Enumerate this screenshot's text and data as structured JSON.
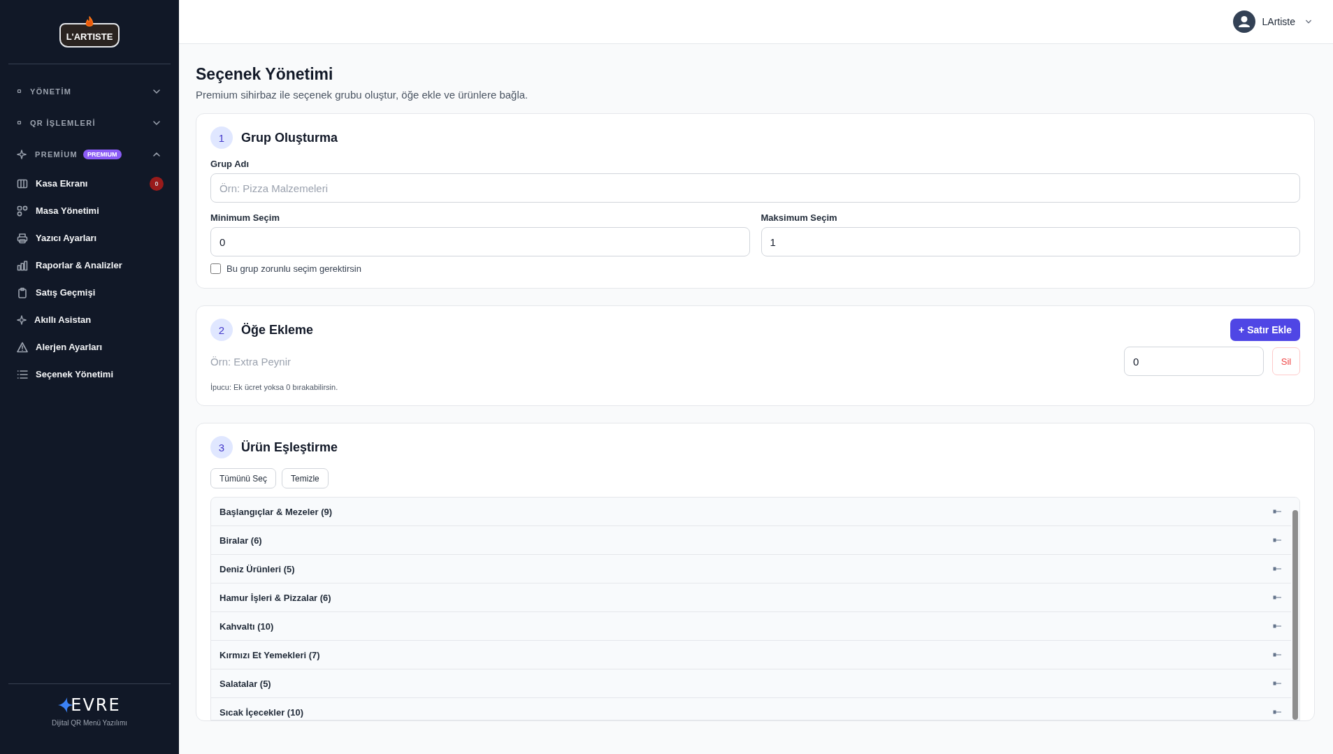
{
  "sidebar": {
    "logo": {
      "text": "L'ARTISTE"
    },
    "groups": [
      {
        "label": "YÖNETİM",
        "expanded": false
      },
      {
        "label": "QR İŞLEMLERİ",
        "expanded": false
      },
      {
        "label": "PREMİUM",
        "badge": "PREMIUM",
        "expanded": true,
        "items": [
          {
            "label": "Kasa Ekranı",
            "count": "0"
          },
          {
            "label": "Masa Yönetimi"
          },
          {
            "label": "Yazıcı Ayarları"
          },
          {
            "label": "Raporlar & Analizler"
          },
          {
            "label": "Satış Geçmişi"
          },
          {
            "label": "Akıllı Asistan"
          },
          {
            "label": "Alerjen Ayarları"
          },
          {
            "label": "Seçenek Yönetimi"
          }
        ]
      }
    ],
    "footer": {
      "brand": "EVRE",
      "caption": "Dijital QR Menü Yazılımı"
    }
  },
  "header": {
    "user": "LArtiste"
  },
  "page": {
    "title": "Seçenek Yönetimi",
    "subtitle": "Premium sihirbaz ile seçenek grubu oluştur, öğe ekle ve ürünlere bağla."
  },
  "group_step": {
    "number": "1",
    "title": "Grup Oluşturma",
    "name_field": {
      "label": "Grup Adı",
      "placeholder": "Örn: Pizza Malzemeleri"
    },
    "min_field": {
      "label": "Minimum Seçim",
      "value": "0"
    },
    "max_field": {
      "label": "Maksimum Seçim",
      "value": "1"
    },
    "required": {
      "label": "Bu grup zorunlu seçim gerektirsin",
      "checked": false
    }
  },
  "items_step": {
    "number": "2",
    "title": "Öğe Ekleme",
    "add_button": "+ Satır Ekle",
    "rows": [
      {
        "name_placeholder": "Örn: Extra Peynir",
        "price": "0",
        "delete": "Sil"
      }
    ],
    "hint": "İpucu: Ek ücret yoksa 0 bırakabilirsin."
  },
  "products_step": {
    "number": "3",
    "title": "Ürün Eşleştirme",
    "buttons": [
      "Tümünü Seç",
      "Temizle"
    ],
    "categories": [
      {
        "label": "Başlangıçlar & Mezeler (9)"
      },
      {
        "label": "Biralar (6)"
      },
      {
        "label": "Deniz Ürünleri (5)"
      },
      {
        "label": "Hamur İşleri & Pizzalar (6)"
      },
      {
        "label": "Kahvaltı (10)"
      },
      {
        "label": "Kırmızı Et Yemekleri (7)"
      },
      {
        "label": "Salatalar (5)"
      },
      {
        "label": "Sıcak İçecekler (10)"
      }
    ]
  }
}
